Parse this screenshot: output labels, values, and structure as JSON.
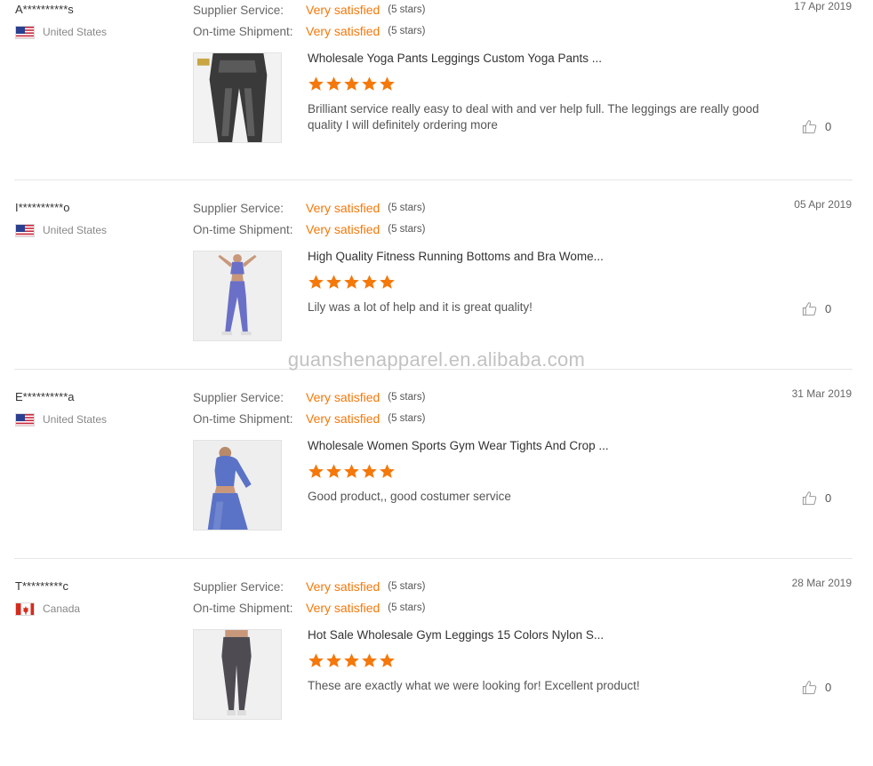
{
  "watermark": "guanshenapparel.en.alibaba.com",
  "reviews": [
    {
      "buyer": "A**********s",
      "country": "United States",
      "country_flag": "us-flag-icon",
      "supplier_service_label": "Supplier Service:",
      "supplier_service_value": "Very satisfied",
      "supplier_service_stars": "(5 stars)",
      "shipment_label": "On-time Shipment:",
      "shipment_value": "Very satisfied",
      "shipment_stars": "(5 stars)",
      "date": "17 Apr 2019",
      "product_title": "Wholesale Yoga Pants Leggings Custom Yoga Pants ...",
      "product_rating": 5,
      "text": "Brilliant service really easy to deal with and ver help full. The leggings are really good quality I will definitely ordering more",
      "likes": "0"
    },
    {
      "buyer": "I**********o",
      "country": "United States",
      "country_flag": "us-flag-icon",
      "supplier_service_label": "Supplier Service:",
      "supplier_service_value": "Very satisfied",
      "supplier_service_stars": "(5 stars)",
      "shipment_label": "On-time Shipment:",
      "shipment_value": "Very satisfied",
      "shipment_stars": "(5 stars)",
      "date": "05 Apr 2019",
      "product_title": "High Quality Fitness Running Bottoms and Bra Wome...",
      "product_rating": 5,
      "text": "Lily was a lot of help and it is great quality!",
      "likes": "0"
    },
    {
      "buyer": "E**********a",
      "country": "United States",
      "country_flag": "us-flag-icon",
      "supplier_service_label": "Supplier Service:",
      "supplier_service_value": "Very satisfied",
      "supplier_service_stars": "(5 stars)",
      "shipment_label": "On-time Shipment:",
      "shipment_value": "Very satisfied",
      "shipment_stars": "(5 stars)",
      "date": "31 Mar 2019",
      "product_title": "Wholesale Women Sports Gym Wear Tights And Crop ...",
      "product_rating": 5,
      "text": "Good product,, good costumer service",
      "likes": "0"
    },
    {
      "buyer": "T*********c",
      "country": "Canada",
      "country_flag": "ca-flag-icon",
      "supplier_service_label": "Supplier Service:",
      "supplier_service_value": "Very satisfied",
      "supplier_service_stars": "(5 stars)",
      "shipment_label": "On-time Shipment:",
      "shipment_value": "Very satisfied",
      "shipment_stars": "(5 stars)",
      "date": "28 Mar 2019",
      "product_title": "Hot Sale Wholesale Gym Leggings 15 Colors Nylon S...",
      "product_rating": 5,
      "text": "These are exactly what we were looking for! Excellent product!",
      "likes": "0"
    }
  ],
  "colors": {
    "accent": "#f5780a",
    "star": "#f5780a",
    "divider": "#e6e6e6",
    "watermark": "#c2c2c2"
  }
}
